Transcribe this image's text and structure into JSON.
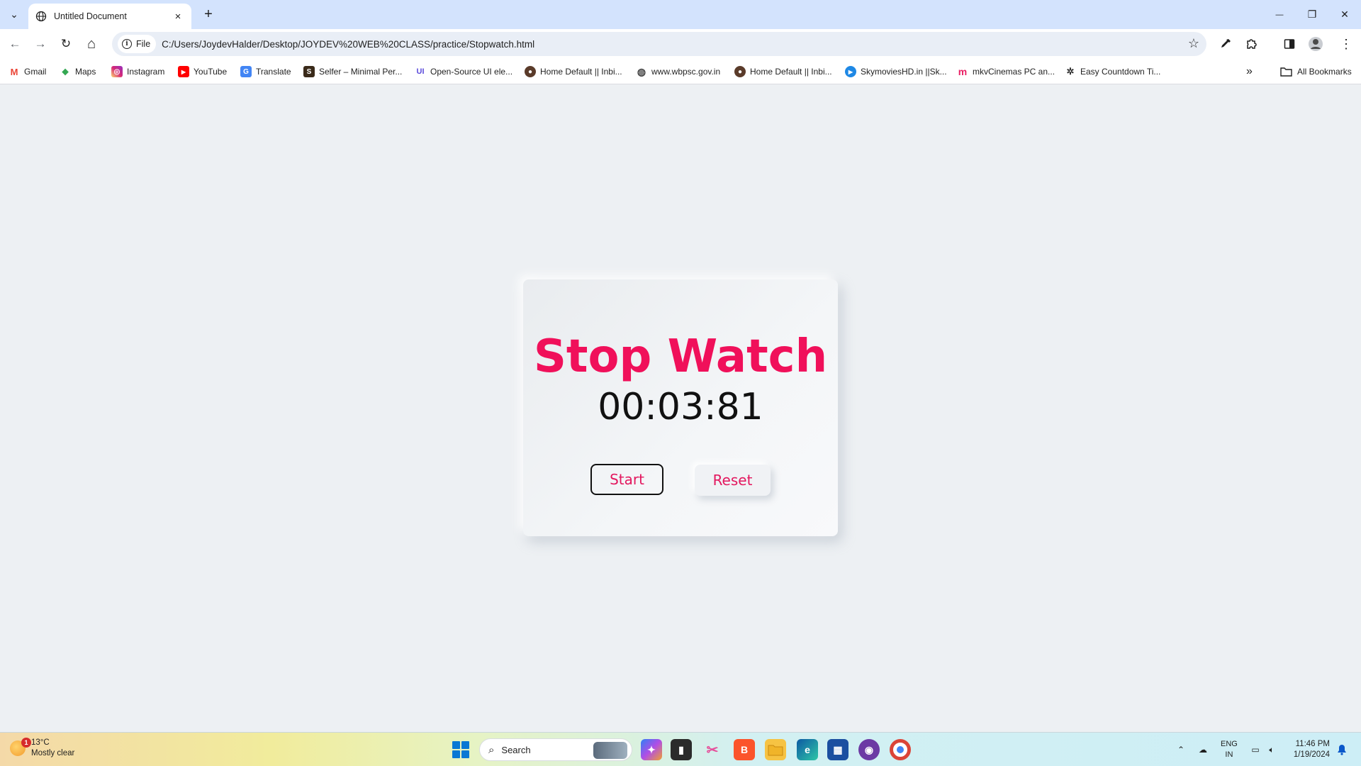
{
  "browser": {
    "tab_title": "Untitled Document",
    "tab_close": "×",
    "new_tab": "+",
    "window_controls": {
      "minimize": "—",
      "restore": "❐",
      "close": "✕"
    },
    "nav": {
      "back": "←",
      "forward": "→",
      "reload": "↻",
      "home": "⌂"
    },
    "omnibox": {
      "chip_label": "File",
      "url": "C:/Users/JoydevHalder/Desktop/JOYDEV%20WEB%20CLASS/practice/Stopwatch.html"
    },
    "bookmarks": [
      {
        "label": "Gmail",
        "icon": "gmail-icon",
        "color": "#ea4335",
        "glyph": "M"
      },
      {
        "label": "Maps",
        "icon": "maps-icon",
        "color": "#34a853",
        "glyph": "◆"
      },
      {
        "label": "Instagram",
        "icon": "instagram-icon",
        "color": "#d6249f",
        "glyph": "◎"
      },
      {
        "label": "YouTube",
        "icon": "youtube-icon",
        "color": "#ff0000",
        "glyph": "▶"
      },
      {
        "label": "Translate",
        "icon": "translate-icon",
        "color": "#4285f4",
        "glyph": "G"
      },
      {
        "label": "Selfer – Minimal Per...",
        "icon": "selfer-icon",
        "color": "#3a2a1a",
        "glyph": "S"
      },
      {
        "label": "Open-Source UI ele...",
        "icon": "uiverse-icon",
        "color": "#5b4bdb",
        "glyph": "UI"
      },
      {
        "label": "Home Default || Inbi...",
        "icon": "avatar-icon",
        "color": "#5a3b2a",
        "glyph": "●"
      },
      {
        "label": "www.wbpsc.gov.in",
        "icon": "globe-icon",
        "color": "#444444",
        "glyph": "◍"
      },
      {
        "label": "Home Default || Inbi...",
        "icon": "avatar-icon",
        "color": "#5a3b2a",
        "glyph": "●"
      },
      {
        "label": "SkymoviesHD.in ||Sk...",
        "icon": "skymovies-icon",
        "color": "#1e88e5",
        "glyph": "▶"
      },
      {
        "label": "mkvCinemas PC an...",
        "icon": "mkvcinemas-icon",
        "color": "#e91e63",
        "glyph": "m"
      },
      {
        "label": "Easy Countdown Ti...",
        "icon": "countdown-icon",
        "color": "#333333",
        "glyph": "✲"
      }
    ],
    "bookmarks_overflow": "»",
    "all_bookmarks": "All Bookmarks"
  },
  "page": {
    "title": "Stop Watch",
    "time": "00:03:81",
    "start_label": "Start",
    "reset_label": "Reset",
    "accent_color": "#f0105a"
  },
  "taskbar": {
    "weather_badge": "1",
    "temperature": "13°C",
    "condition": "Mostly clear",
    "search_placeholder": "Search",
    "lang_line1": "ENG",
    "lang_line2": "IN",
    "time": "11:46 PM",
    "date": "1/19/2024"
  }
}
